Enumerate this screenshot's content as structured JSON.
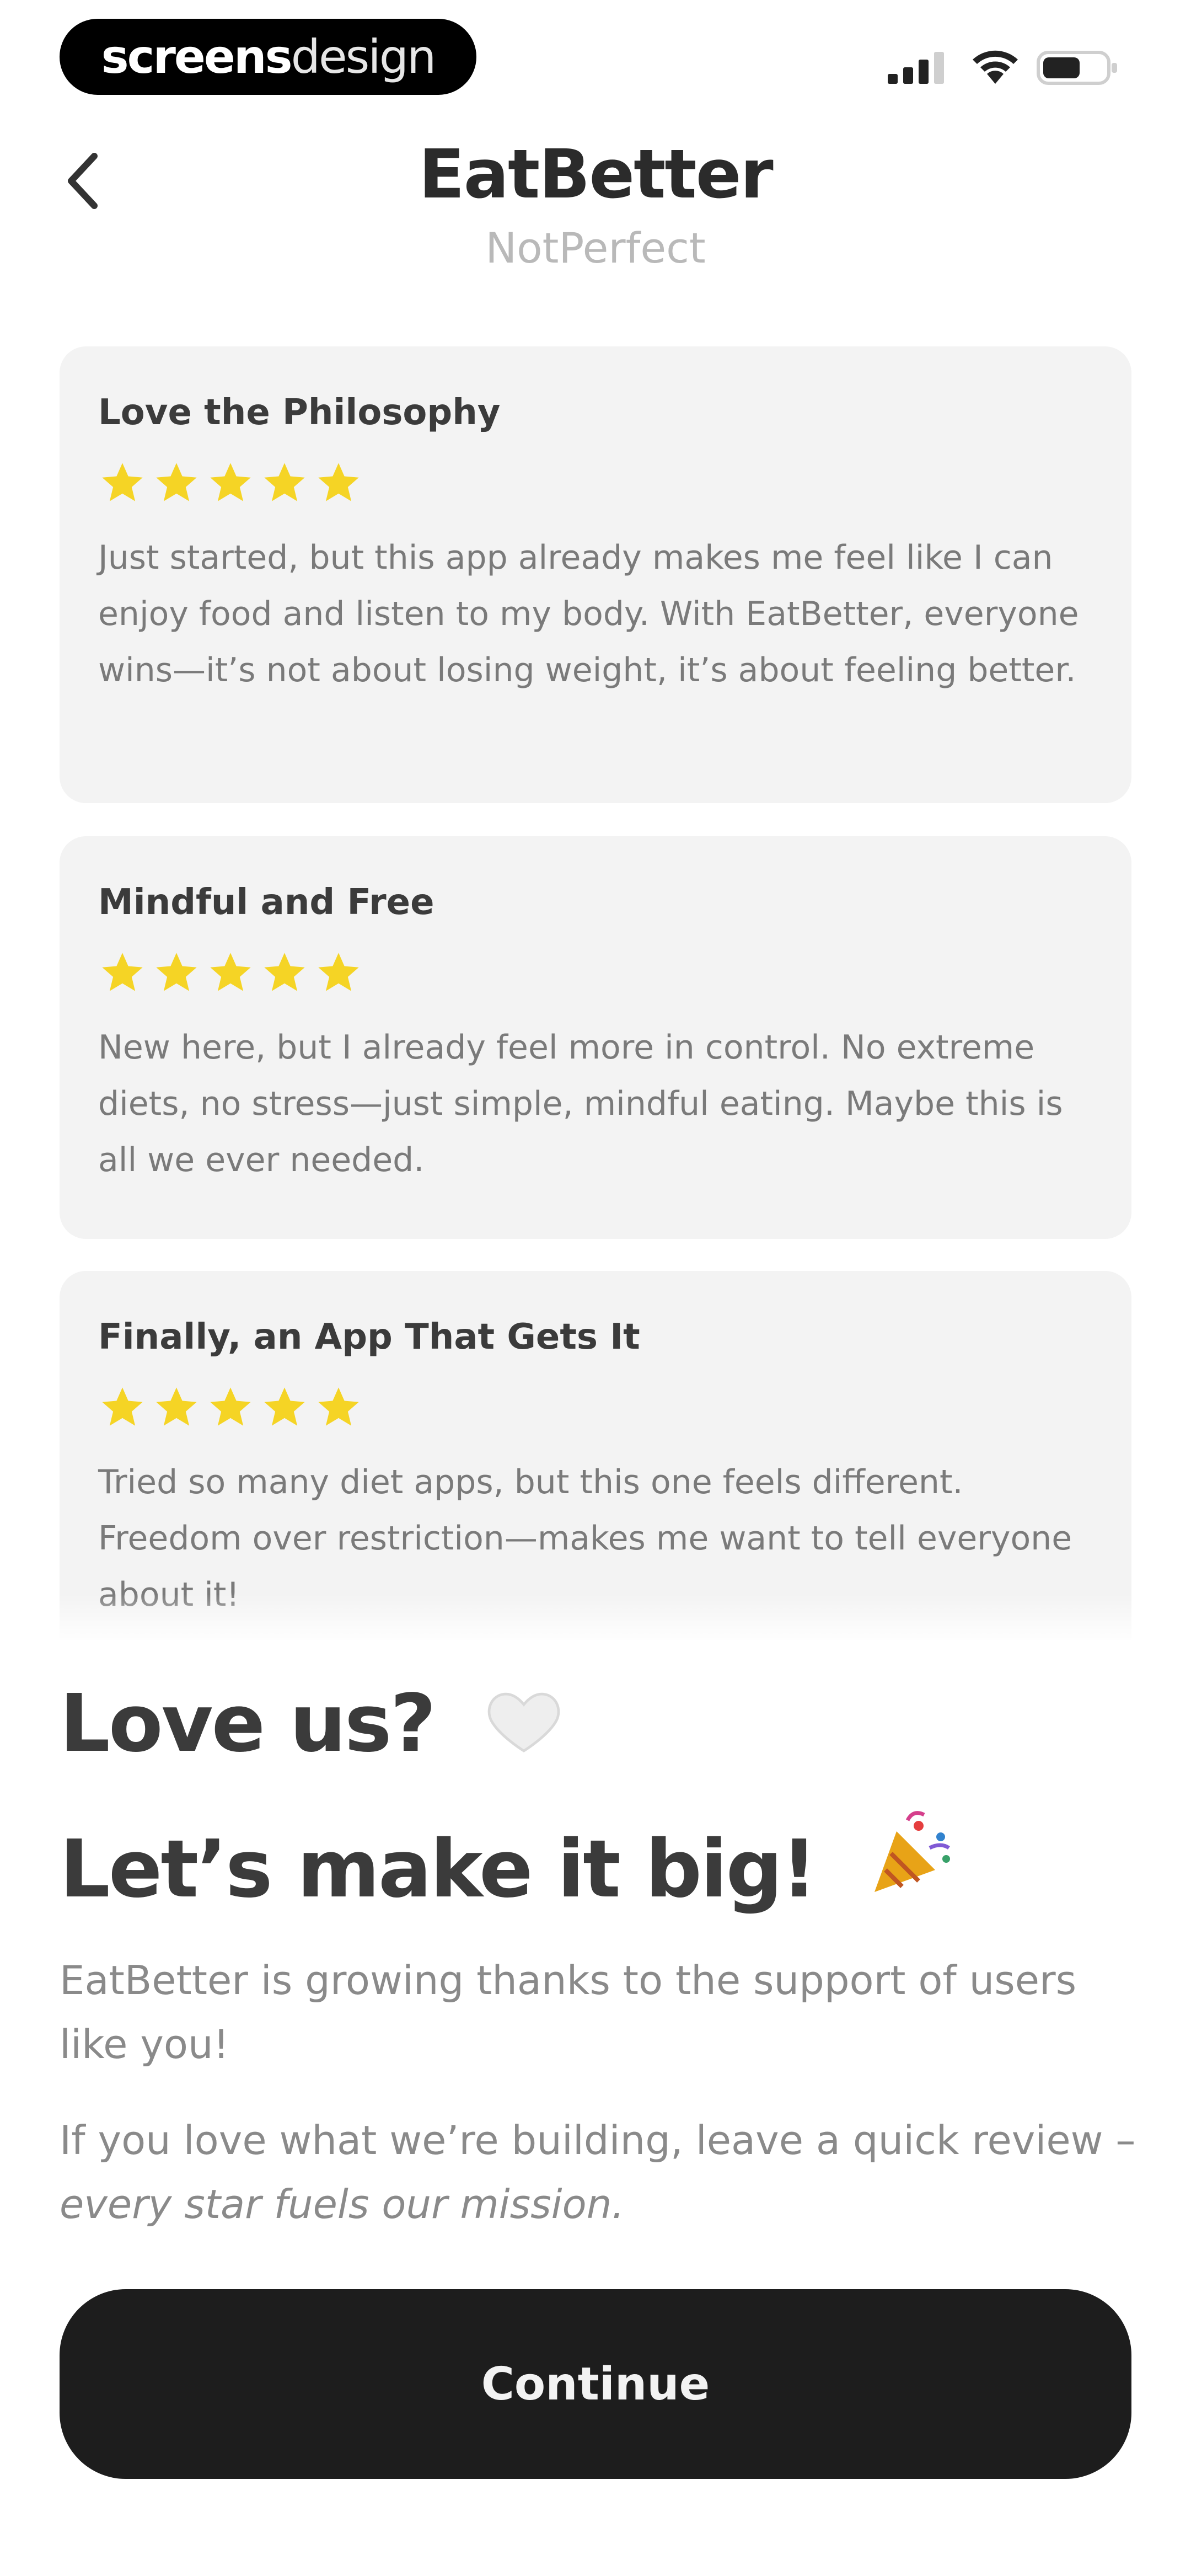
{
  "status_bar": {
    "brand_bold": "screens",
    "brand_light": "design",
    "icons": [
      "cellular-signal-icon",
      "wifi-icon",
      "battery-icon"
    ]
  },
  "header": {
    "back_icon": "chevron-left-icon",
    "title": "EatBetter",
    "subtitle": "NotPerfect"
  },
  "reviews": [
    {
      "title": "Love the Philosophy",
      "rating": 5,
      "text": "Just started, but this app already makes me feel like I can enjoy food and listen to my body. With EatBetter, everyone wins—it’s not about losing weight, it’s about feeling better."
    },
    {
      "title": "Mindful and Free",
      "rating": 5,
      "text": "New here, but I already feel more in control. No extreme diets, no stress—just simple, mindful eating. Maybe this is all we ever needed."
    },
    {
      "title": "Finally, an App That Gets It",
      "rating": 5,
      "text": "Tried so many diet apps, but this one feels different. Freedom over restriction—makes me want to tell everyone about it!"
    }
  ],
  "promo": {
    "headline_1": "Love us?",
    "headline_1_emoji": "🤍",
    "headline_2": "Let’s make it big!",
    "headline_2_emoji": "🎉",
    "body_1": "EatBetter is growing thanks to the support of users like you!",
    "body_2_prefix": "If you love what we’re building, leave a quick review – ",
    "body_2_italic": "every star fuels our mission."
  },
  "continue_label": "Continue",
  "colors": {
    "star": "#F5D425",
    "card_bg": "#F3F3F3",
    "button_bg": "#1D1D1D"
  }
}
